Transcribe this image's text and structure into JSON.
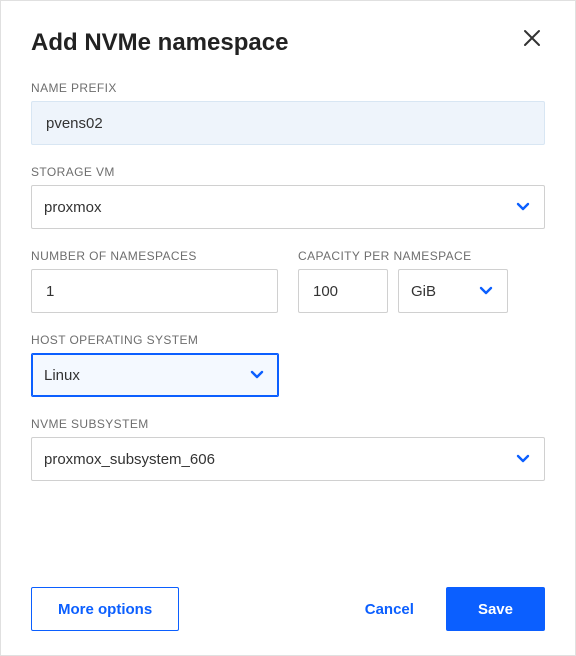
{
  "dialog": {
    "title": "Add NVMe namespace"
  },
  "fields": {
    "namePrefix": {
      "label": "NAME PREFIX",
      "value": "pvens02"
    },
    "storageVm": {
      "label": "STORAGE VM",
      "value": "proxmox"
    },
    "numNamespaces": {
      "label": "NUMBER OF NAMESPACES",
      "value": "1"
    },
    "capacity": {
      "label": "CAPACITY PER NAMESPACE",
      "value": "100",
      "unit": "GiB"
    },
    "hostOs": {
      "label": "HOST OPERATING SYSTEM",
      "value": "Linux"
    },
    "subsystem": {
      "label": "NVME SUBSYSTEM",
      "value": "proxmox_subsystem_606"
    }
  },
  "actions": {
    "moreOptions": "More options",
    "cancel": "Cancel",
    "save": "Save"
  },
  "colors": {
    "accent": "#0b5fff"
  }
}
